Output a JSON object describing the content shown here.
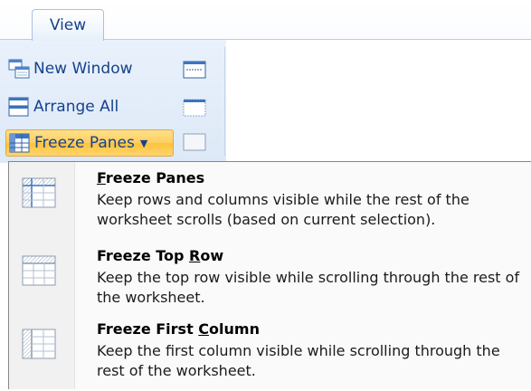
{
  "ribbon": {
    "tab_label": "View",
    "buttons": [
      {
        "label": "New Window",
        "icon": "new-window-icon"
      },
      {
        "label": "Arrange All",
        "icon": "arrange-all-icon"
      },
      {
        "label": "Freeze Panes",
        "icon": "freeze-panes-icon",
        "state": "open",
        "arrow": "▼"
      }
    ],
    "small_icons": [
      "split-icon",
      "hide-icon",
      "unhide-icon"
    ]
  },
  "menu": {
    "items": [
      {
        "title_pre": "",
        "title_key": "F",
        "title_post": "reeze Panes",
        "description": "Keep rows and columns visible while the rest of the worksheet scrolls (based on current selection).",
        "icon": "freeze-panes-option-icon"
      },
      {
        "title_pre": "Freeze Top ",
        "title_key": "R",
        "title_post": "ow",
        "description": "Keep the top row visible while scrolling through the rest of the worksheet.",
        "icon": "freeze-top-row-icon"
      },
      {
        "title_pre": "Freeze First ",
        "title_key": "C",
        "title_post": "olumn",
        "description": "Keep the first column visible while scrolling through the rest of the worksheet.",
        "icon": "freeze-first-column-icon"
      }
    ]
  },
  "colors": {
    "ribbon_text": "#15428b",
    "ribbon_bg": "#dde9f7",
    "active_button": "#ffc23c",
    "menu_gutter": "#f1f1f1"
  }
}
